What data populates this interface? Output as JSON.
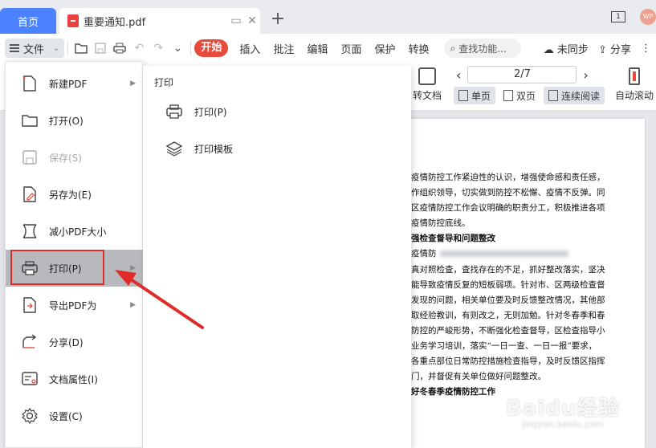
{
  "titlebar": {
    "home_tab": "首页",
    "doc_tab": "重要通知.pdf",
    "add_tab": "+",
    "page_badge": "1",
    "avatar_text": "WP"
  },
  "toolbar": {
    "file_menu_label": "文件",
    "ribbon_tabs": [
      "开始",
      "插入",
      "批注",
      "编辑",
      "页面",
      "保护",
      "转换"
    ],
    "search_placeholder": "查找功能...",
    "sync_label": "未同步",
    "share_label": "分享"
  },
  "subtoolbar": {
    "convert_label": "转文档",
    "page_indicator": "2/7",
    "single_page": "单页",
    "double_page": "双页",
    "continuous": "连续阅读",
    "auto_scroll": "自动滚动"
  },
  "file_menu": {
    "items": [
      {
        "label": "新建PDF",
        "icon": "new-pdf-icon",
        "has_submenu": true,
        "disabled": false
      },
      {
        "label": "打开(O)",
        "icon": "folder-open-icon",
        "has_submenu": false,
        "disabled": false
      },
      {
        "label": "保存(S)",
        "icon": "save-icon",
        "has_submenu": false,
        "disabled": true
      },
      {
        "label": "另存为(E)",
        "icon": "save-as-icon",
        "has_submenu": false,
        "disabled": false
      },
      {
        "label": "减小PDF大小",
        "icon": "compress-icon",
        "has_submenu": false,
        "disabled": false
      },
      {
        "label": "打印(P)",
        "icon": "printer-icon",
        "has_submenu": true,
        "disabled": false,
        "active": true
      },
      {
        "label": "导出PDF为",
        "icon": "export-icon",
        "has_submenu": true,
        "disabled": false
      },
      {
        "label": "分享(D)",
        "icon": "share-icon",
        "has_submenu": false,
        "disabled": false
      },
      {
        "label": "文档属性(I)",
        "icon": "properties-icon",
        "has_submenu": false,
        "disabled": false
      },
      {
        "label": "设置(C)",
        "icon": "settings-icon",
        "has_submenu": false,
        "disabled": false
      }
    ]
  },
  "print_submenu": {
    "title": "打印",
    "items": [
      {
        "label": "打印(P)",
        "icon": "printer-icon"
      },
      {
        "label": "打印模板",
        "icon": "layers-icon"
      }
    ]
  },
  "document": {
    "lines": [
      {
        "text": "疫情防控工作紧迫性的认识，增强使命感和责任感，",
        "bold": false
      },
      {
        "text": "作组织领导，切实做到防控不松懈、疫情不反弹。同",
        "bold": false
      },
      {
        "text": "区疫情防控工作会议明确的职责分工，积极推进各项",
        "bold": false
      },
      {
        "text": "疫情防控底线。",
        "bold": false
      },
      {
        "text": "强检查督导和问题整改",
        "bold": true
      },
      {
        "text": "疫情防",
        "bold": false,
        "blur": true
      },
      {
        "text": "真对照检查，查找存在的不足，抓好整改落实，坚决",
        "bold": false
      },
      {
        "text": "能导致疫情反复的短板弱项。针对市、区两级检查督",
        "bold": false
      },
      {
        "text": "发现的问题，相关单位要及时反馈整改情况，其他部",
        "bold": false
      },
      {
        "text": "取经验教训，有则改之，无则加勉。针对冬春季和春",
        "bold": false
      },
      {
        "text": "防控的严峻形势，不断强化检查督导，区检查指导小",
        "bold": false
      },
      {
        "text": "业务学习培训，落实“一日一查、一日一报”要求，",
        "bold": false
      },
      {
        "text": "各重点部位日常防控措施检查指导，及时反馈区指挥",
        "bold": false
      },
      {
        "text": "门，并督促有关单位做好问题整改。",
        "bold": false
      },
      {
        "text": "好冬春季疫情防控工作",
        "bold": true
      }
    ]
  },
  "watermark": {
    "brand": "Baidu经验",
    "url": "jingyan.baidu.com"
  },
  "colors": {
    "accent_blue": "#4a82ff",
    "accent_red": "#e74b3c",
    "annotation_red": "#e02b2b"
  }
}
